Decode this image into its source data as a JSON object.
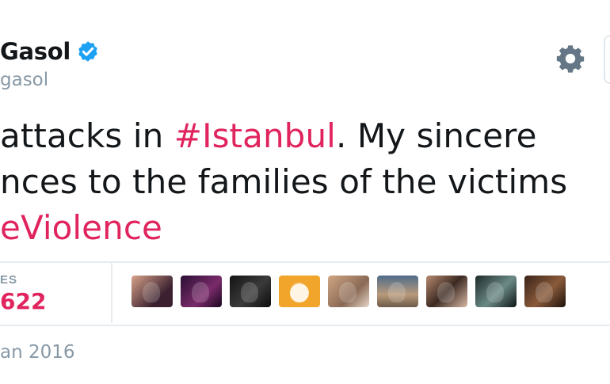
{
  "tweet": {
    "display_name": "Gasol",
    "handle": "gasol",
    "text_segments": [
      [
        {
          "text": "attacks in ",
          "hashtag": false
        },
        {
          "text": "#Istanbul",
          "hashtag": true
        },
        {
          "text": ". My sincere",
          "hashtag": false
        }
      ],
      [
        {
          "text": "nces to the families of the victims",
          "hashtag": false
        }
      ],
      [
        {
          "text": "eViolence",
          "hashtag": true
        }
      ]
    ],
    "likes_label": "ES",
    "likes_count": "622",
    "date": "an 2016"
  },
  "icons": {
    "verified": "verified-badge-icon",
    "settings": "gear-icon"
  },
  "colors": {
    "hashtag": "#e0245e",
    "likes": "#e0245e",
    "verified": "#1da1f2",
    "muted": "#8899a6",
    "text": "#14171a",
    "divider": "#e6ecf0"
  },
  "liker_avatars": [
    {
      "bg": "linear-gradient(135deg,#d9a48a,#3b2130 70%)"
    },
    {
      "bg": "linear-gradient(135deg,#2a1033,#7a2a6a 60%,#1a0820)"
    },
    {
      "bg": "linear-gradient(135deg,#141414,#3a3a3a 55%,#0c0c0c)"
    },
    {
      "bg": "radial-gradient(circle at 50% 55%,#fff3df 0 34%,#f2a52b 36%)"
    },
    {
      "bg": "linear-gradient(135deg,#cfa584,#8a6a55 60%,#e6d5c8)"
    },
    {
      "bg": "linear-gradient(180deg,#4f6b8a,#b89a7a 60%,#6d5a48)"
    },
    {
      "bg": "linear-gradient(135deg,#b88a70,#3c2a22 50%,#d9b9a5)"
    },
    {
      "bg": "linear-gradient(135deg,#1e2a2a,#6b8a86 55%,#0f1515)"
    },
    {
      "bg": "linear-gradient(135deg,#3a2418,#8a5a3a 55%,#1e120c)"
    }
  ]
}
